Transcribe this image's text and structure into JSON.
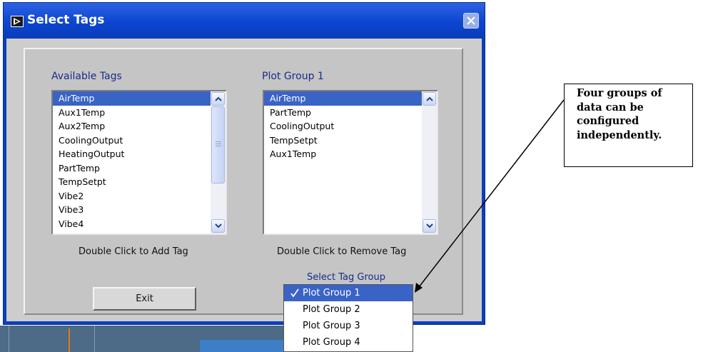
{
  "window": {
    "title": "Select Tags",
    "icon": "labview-run-icon",
    "close_icon": "close-icon"
  },
  "available": {
    "heading": "Available Tags",
    "items": [
      "AirTemp",
      "Aux1Temp",
      "Aux2Temp",
      "CoolingOutput",
      "HeatingOutput",
      "PartTemp",
      "TempSetpt",
      "Vibe2",
      "Vibe3",
      "Vibe4"
    ],
    "selected": "AirTemp",
    "hint": "Double Click to Add Tag"
  },
  "plot_group": {
    "heading": "Plot Group 1",
    "items": [
      "AirTemp",
      "PartTemp",
      "CoolingOutput",
      "TempSetpt",
      "Aux1Temp"
    ],
    "selected": "AirTemp",
    "hint": "Double Click to Remove Tag"
  },
  "exit_label": "Exit",
  "tag_group": {
    "label": "Select Tag Group",
    "check_icon": "checkmark-icon",
    "options": [
      "Plot Group 1",
      "Plot Group 2",
      "Plot Group 3",
      "Plot Group 4"
    ],
    "selected": "Plot Group 1"
  },
  "callout": {
    "lines": [
      "Four groups of",
      "data can be",
      "configured",
      "independently."
    ]
  },
  "colors": {
    "titlebar": "#0b45d0",
    "selection": "#3a63c6",
    "heading_text": "#1a2a8a"
  }
}
